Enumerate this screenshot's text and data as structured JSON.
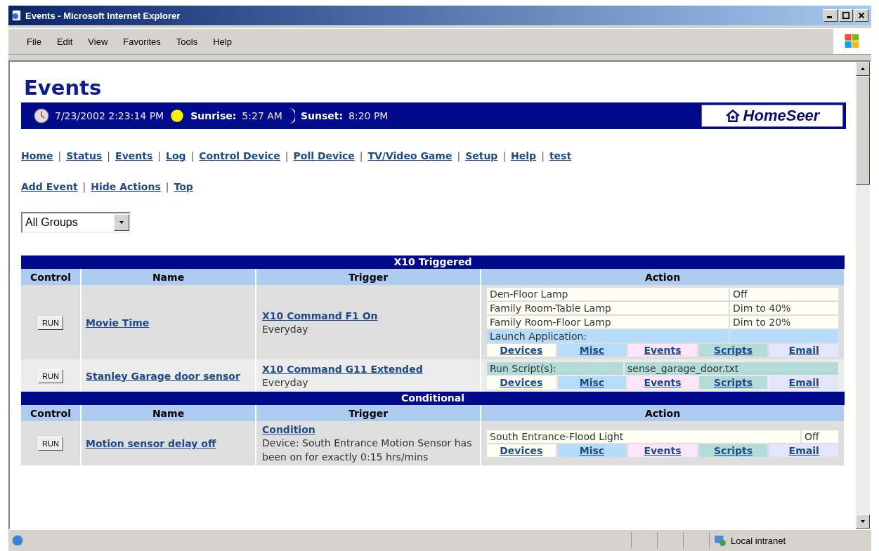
{
  "window": {
    "title": "Events - Microsoft Internet Explorer"
  },
  "menu": [
    "File",
    "Edit",
    "View",
    "Favorites",
    "Tools",
    "Help"
  ],
  "page": {
    "heading": "Events",
    "datetime": "7/23/2002 2:23:14 PM",
    "sunrise_label": "Sunrise:",
    "sunrise": "5:27 AM",
    "sunset_label": "Sunset:",
    "sunset": "8:20 PM",
    "logo": "HomeSeer"
  },
  "nav": [
    "Home",
    "Status",
    "Events",
    "Log",
    "Control Device",
    "Poll Device",
    "TV/Video Game",
    "Setup",
    "Help",
    "test"
  ],
  "nav_separator": "|",
  "subnav": [
    "Add Event",
    "Hide Actions",
    "Top"
  ],
  "group_select": {
    "value": "All Groups"
  },
  "sections": [
    {
      "title": "X10 Triggered",
      "columns": [
        "Control",
        "Name",
        "Trigger",
        "Action"
      ],
      "rows": [
        {
          "run": "RUN",
          "name": "Movie Time",
          "trigger": "X10 Command F1 On",
          "trigger_detail": "Everyday",
          "actions": [
            {
              "kind": "device",
              "label": "Den-Floor Lamp",
              "value": "Off"
            },
            {
              "kind": "device",
              "label": "Family Room-Table Lamp",
              "value": "Dim to 40%"
            },
            {
              "kind": "device",
              "label": "Family Room-Floor Lamp",
              "value": "Dim to 20%"
            },
            {
              "kind": "app",
              "label": "Launch Application:"
            }
          ],
          "action_links": [
            {
              "label": "Devices",
              "color": "#fffef5"
            },
            {
              "label": "Misc",
              "color": "#b5dcfa"
            },
            {
              "label": "Events",
              "color": "#fde6fb"
            },
            {
              "label": "Scripts",
              "color": "#b3dcd8"
            },
            {
              "label": "Email",
              "color": "#e3e5fb"
            }
          ]
        },
        {
          "run": "RUN",
          "name": "Stanley Garage door sensor",
          "trigger": "X10 Command G11 Extended",
          "trigger_detail": "Everyday",
          "actions": [
            {
              "kind": "script",
              "label": "Run Script(s):",
              "value": "sense_garage_door.txt"
            }
          ],
          "action_links": [
            {
              "label": "Devices",
              "color": "#fffef5"
            },
            {
              "label": "Misc",
              "color": "#b5dcfa"
            },
            {
              "label": "Events",
              "color": "#fde6fb"
            },
            {
              "label": "Scripts",
              "color": "#b3dcd8"
            },
            {
              "label": "Email",
              "color": "#e3e5fb"
            }
          ]
        }
      ]
    },
    {
      "title": "Conditional",
      "columns": [
        "Control",
        "Name",
        "Trigger",
        "Action"
      ],
      "rows": [
        {
          "run": "RUN",
          "name": "Motion sensor delay off",
          "trigger": "Condition",
          "trigger_detail": "Device: South Entrance Motion Sensor has been on for exactly 0:15 hrs/mins",
          "actions": [
            {
              "kind": "device_wide",
              "label": "South Entrance-Flood Light",
              "value": "Off"
            }
          ],
          "action_links": [
            {
              "label": "Devices",
              "color": "#fffef5"
            },
            {
              "label": "Misc",
              "color": "#b5dcfa"
            },
            {
              "label": "Events",
              "color": "#fde6fb"
            },
            {
              "label": "Scripts",
              "color": "#b3dcd8"
            },
            {
              "label": "Email",
              "color": "#e3e5fb"
            }
          ]
        }
      ]
    }
  ],
  "status_bar": {
    "zone": "Local intranet"
  }
}
